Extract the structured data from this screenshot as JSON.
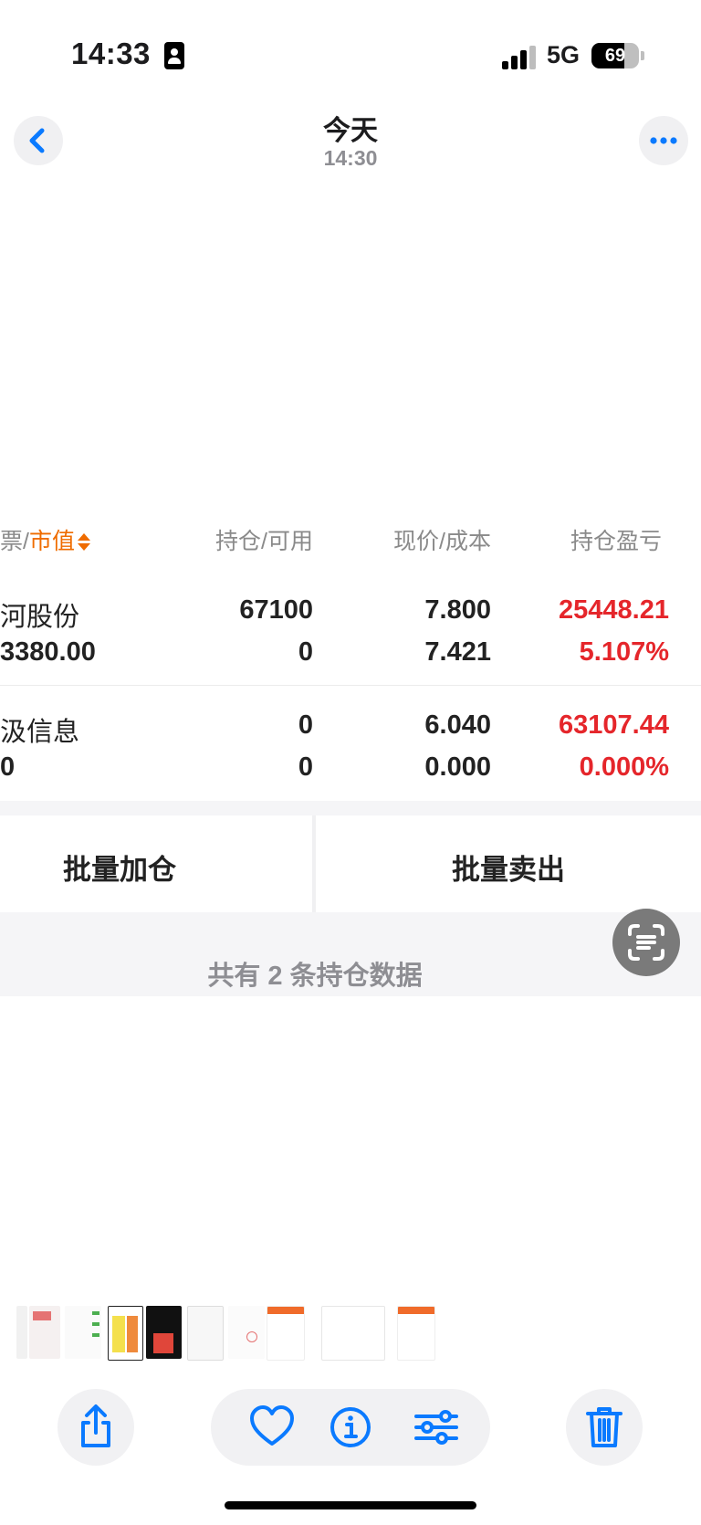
{
  "status": {
    "time": "14:33",
    "network": "5G",
    "battery": "69",
    "battery_level": 0.69
  },
  "nav": {
    "title": "今天",
    "subtitle": "14:30"
  },
  "table": {
    "headers": {
      "h0_prefix": "票/",
      "h0_main": "市值",
      "h1": "持仓/可用",
      "h2": "现价/成本",
      "h3": "持仓盈亏"
    },
    "rows": [
      {
        "name": "河股份",
        "sub": "3380.00",
        "hold": "67100",
        "avail": "0",
        "price": "7.800",
        "cost": "7.421",
        "pnl": "25448.21",
        "pct": "5.107%"
      },
      {
        "name": "汲信息",
        "sub": "0",
        "hold": "0",
        "avail": "0",
        "price": "6.040",
        "cost": "0.000",
        "pnl": "63107.44",
        "pct": "0.000%"
      }
    ]
  },
  "actions": {
    "add": "批量加仓",
    "sell": "批量卖出"
  },
  "footer": {
    "count_text": "共有 2 条持仓数据"
  },
  "colors": {
    "accent": "#ef6c00",
    "loss_gain": "#e5262b",
    "ios_blue": "#0a7aff"
  }
}
